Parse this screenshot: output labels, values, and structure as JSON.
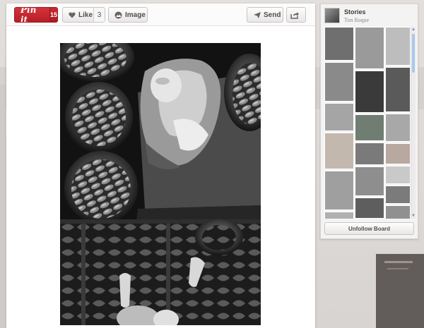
{
  "toolbar": {
    "pinit_label": "Pin it",
    "pinit_count": "15",
    "like_label": "Like",
    "like_count": "3",
    "image_label": "Image",
    "send_label": "Send"
  },
  "board": {
    "title": "Stories",
    "user": "Ton Roque",
    "unfollow_label": "Unfollow Board"
  },
  "colors": {
    "pinit_red": "#c92a33",
    "scroll_blue": "#a9c8ea"
  }
}
